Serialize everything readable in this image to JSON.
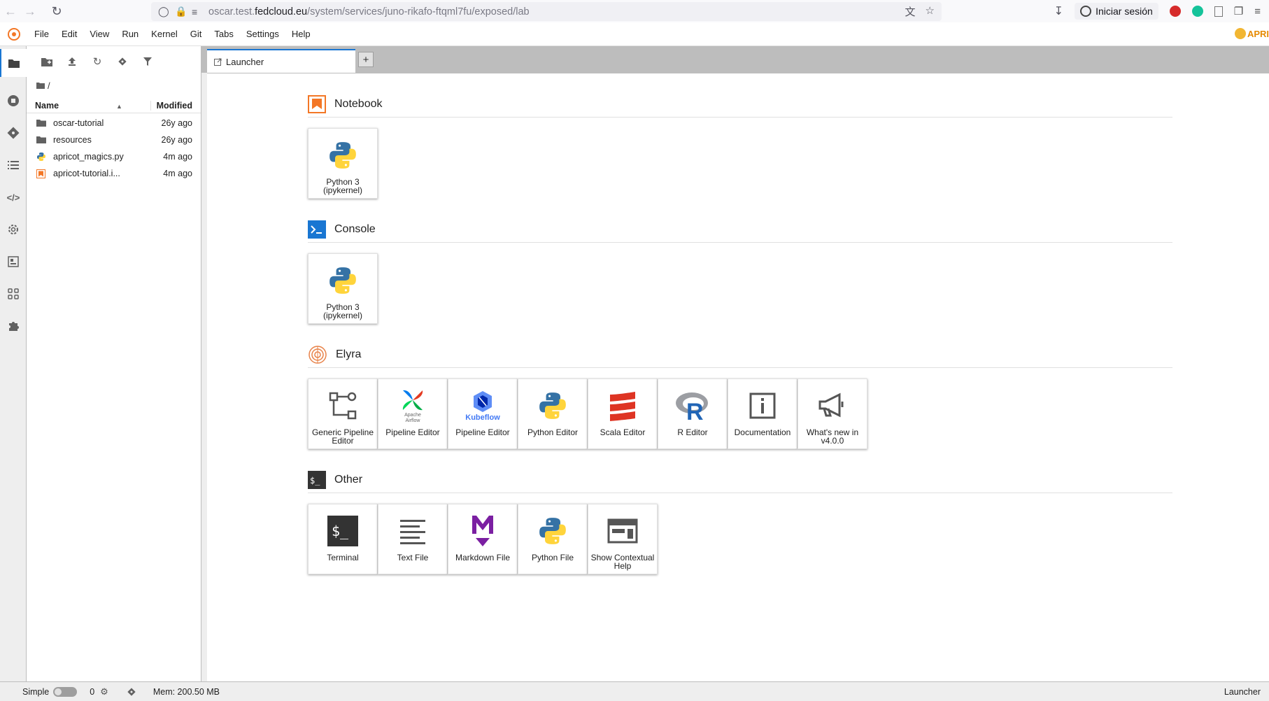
{
  "browser": {
    "url_prefix": "oscar.test.",
    "url_host": "fedcloud.eu",
    "url_path": "/system/services/juno-rikafo-ftqml7fu/exposed/lab",
    "signin_label": "Iniciar sesión"
  },
  "menubar": {
    "items": [
      "File",
      "Edit",
      "View",
      "Run",
      "Kernel",
      "Git",
      "Tabs",
      "Settings",
      "Help"
    ],
    "brand": "APRI"
  },
  "filebrowser": {
    "breadcrumb": "/",
    "col_name": "Name",
    "col_modified": "Modified",
    "files": [
      {
        "name": "oscar-tutorial",
        "modified": "26y ago",
        "type": "folder"
      },
      {
        "name": "resources",
        "modified": "26y ago",
        "type": "folder"
      },
      {
        "name": "apricot_magics.py",
        "modified": "4m ago",
        "type": "python"
      },
      {
        "name": "apricot-tutorial.i...",
        "modified": "4m ago",
        "type": "notebook"
      }
    ]
  },
  "tabs": {
    "active_label": "Launcher",
    "add_label": "+"
  },
  "launcher": {
    "notebook": {
      "title": "Notebook",
      "cards": [
        {
          "label": "Python 3 (ipykernel)"
        }
      ]
    },
    "console": {
      "title": "Console",
      "cards": [
        {
          "label": "Python 3 (ipykernel)"
        }
      ]
    },
    "elyra": {
      "title": "Elyra",
      "cards": [
        {
          "label": "Generic Pipeline Editor"
        },
        {
          "label": "Pipeline Editor",
          "sub": "Apache Airflow"
        },
        {
          "label": "Pipeline Editor",
          "sub": "Kubeflow"
        },
        {
          "label": "Python Editor"
        },
        {
          "label": "Scala Editor"
        },
        {
          "label": "R Editor"
        },
        {
          "label": "Documentation"
        },
        {
          "label": "What's new in v4.0.0"
        }
      ]
    },
    "other": {
      "title": "Other",
      "cards": [
        {
          "label": "Terminal"
        },
        {
          "label": "Text File"
        },
        {
          "label": "Markdown File"
        },
        {
          "label": "Python File"
        },
        {
          "label": "Show Contextual Help"
        }
      ]
    }
  },
  "statusbar": {
    "mode_label": "Simple",
    "kernels": "0",
    "memory": "Mem: 200.50 MB",
    "right_label": "Launcher"
  },
  "colors": {
    "accent": "#1976d2",
    "notebook_orange": "#f37726",
    "python_blue": "#3572a5",
    "python_yellow": "#ffd43b",
    "scala_red": "#de3423",
    "markdown_purple": "#7b1fa2"
  }
}
